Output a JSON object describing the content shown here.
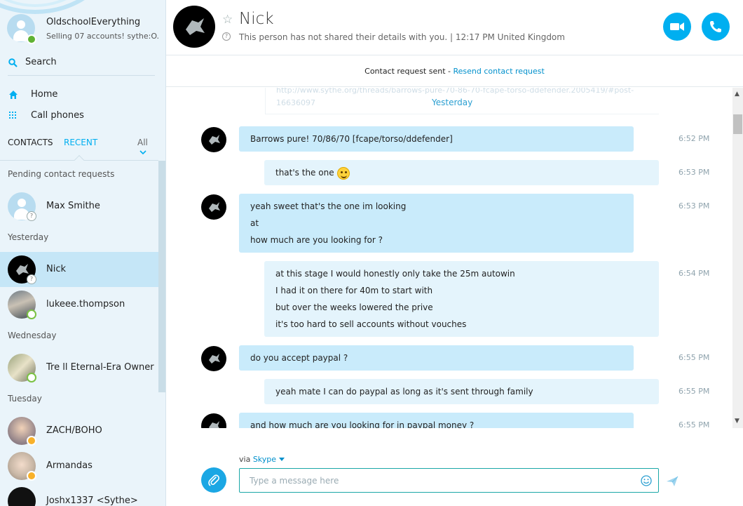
{
  "profile": {
    "name": "OldschoolEverything",
    "mood": "Selling 07 accounts! sythe:O..."
  },
  "search": {
    "label": "Search"
  },
  "nav": {
    "home": "Home",
    "call_phones": "Call phones"
  },
  "tabs": {
    "contacts": "CONTACTS",
    "recent": "RECENT",
    "filter": "All"
  },
  "sections": {
    "pending": "Pending contact requests",
    "yesterday": "Yesterday",
    "wednesday": "Wednesday",
    "tuesday": "Tuesday"
  },
  "contacts": {
    "max": "Max Smithe",
    "nick": "Nick",
    "lukeee": "lukeee.thompson",
    "tre": "Tre ll Eternal-Era Owner",
    "zach": "ZACH/BOHO",
    "armandas": "Armandas",
    "joshx": "Joshx1337 <Sythe>"
  },
  "conversation": {
    "name": "Nick",
    "info": "This person has not shared their details with you.  |  12:17 PM United Kingdom"
  },
  "notice": {
    "text": "Contact request sent - ",
    "link": "Resend contact request"
  },
  "ghost_url": "http://www.sythe.org/threads/barrows-pure-70-86-70-fcape-torso-ddefender.2005419/#post-16636097",
  "day_separator": "Yesterday",
  "messages": [
    {
      "lines": [
        "Barrows pure! 70/86/70 [fcape/torso/ddefender]"
      ],
      "time": "6:52 PM"
    },
    {
      "lines": [
        "that's the one"
      ],
      "time": "6:53 PM"
    },
    {
      "lines": [
        "yeah sweet that's the one im looking",
        "at",
        "how much are you looking for ?"
      ],
      "time": "6:53 PM"
    },
    {
      "lines": [
        "at this stage I would honestly only take the 25m autowin",
        "I had it on there for 40m to start with",
        "but over the weeks lowered the prive",
        "it's too hard to sell accounts without vouches"
      ],
      "time": "6:54 PM"
    },
    {
      "lines": [
        "do you accept paypal ?"
      ],
      "time": "6:55 PM"
    },
    {
      "lines": [
        "yeah mate I can do paypal as long as it's sent through family"
      ],
      "time": "6:55 PM"
    },
    {
      "lines": [
        "and how much are you looking for in paypal money ?"
      ],
      "time": "6:55 PM"
    }
  ],
  "compose": {
    "via_label": "via",
    "via_service": "Skype",
    "placeholder": "Type a message here"
  },
  "colors": {
    "accent": "#00aff0",
    "incoming_bubble": "#c9ebfb",
    "outgoing_bubble": "#e4f4fc"
  }
}
